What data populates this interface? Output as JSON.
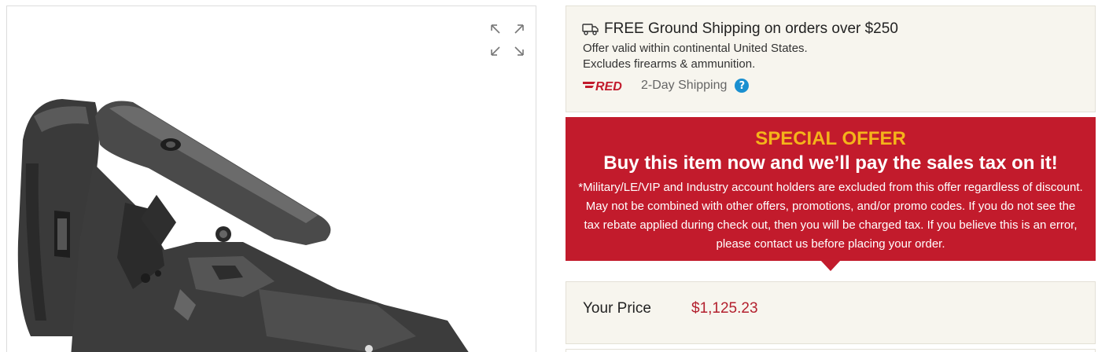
{
  "product_image": {
    "alt": "Adjustable precision rifle buttstock",
    "expand_icon": "expand-arrows-icon"
  },
  "shipping": {
    "icon": "truck-icon",
    "title": "FREE Ground Shipping on orders over $250",
    "line1": "Offer valid within continental United States.",
    "line2": "Excludes firearms & ammunition.",
    "red_logo": "RED",
    "red_label": "2-Day Shipping",
    "help_icon": "?"
  },
  "special_offer": {
    "heading": "SPECIAL OFFER",
    "subheading": "Buy this item now and we’ll pay the sales tax on it!",
    "body": "*Military/LE/VIP and Industry account holders are excluded from this offer regardless of discount. May not be combined with other offers, promotions, and/or promo codes. If you do not see the tax rebate applied during check out, then you will be charged tax. If you believe this is an error, please contact us before placing your order.",
    "colors": {
      "background": "#c21b2c",
      "heading": "#f4b41a"
    }
  },
  "price": {
    "label": "Your Price",
    "value": "$1,125.23",
    "color": "#b3202e"
  }
}
